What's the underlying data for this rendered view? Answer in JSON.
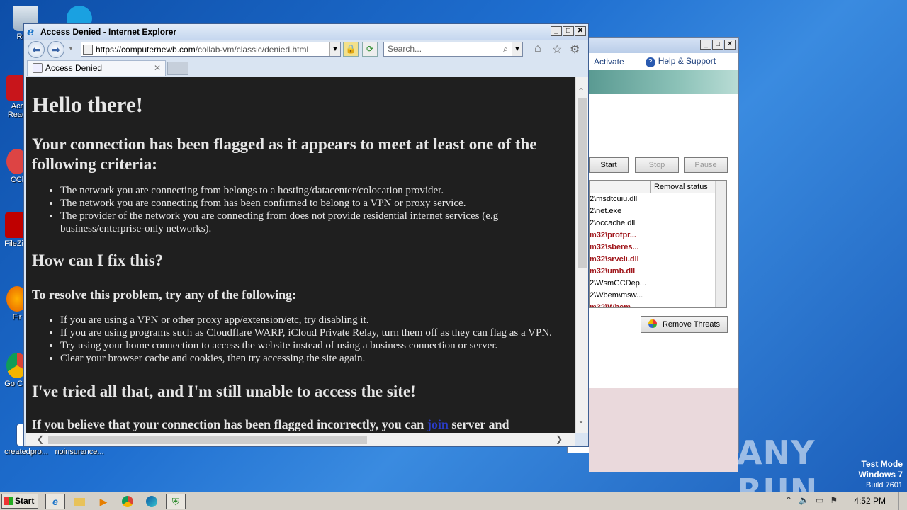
{
  "desktop": {
    "icons": [
      {
        "label": "Recy"
      },
      {
        "label": "Acr Read"
      },
      {
        "label": "CCl"
      },
      {
        "label": "FileZill"
      },
      {
        "label": "Fir"
      },
      {
        "label": "Go Chr"
      },
      {
        "label": "createdpro..."
      },
      {
        "label": "noinsurance..."
      }
    ]
  },
  "bgwindow": {
    "activate": "Activate",
    "help": "Help & Support",
    "start": "Start",
    "stop": "Stop",
    "pause": "Pause",
    "column": "Removal status",
    "rows": [
      {
        "text": "2\\msdtcuiu.dll",
        "red": false
      },
      {
        "text": "2\\net.exe",
        "red": false
      },
      {
        "text": "2\\occache.dll",
        "red": false
      },
      {
        "text": "m32\\profpr...",
        "red": true
      },
      {
        "text": "m32\\sberes...",
        "red": true
      },
      {
        "text": "m32\\srvcli.dll",
        "red": true
      },
      {
        "text": "m32\\umb.dll",
        "red": true
      },
      {
        "text": "2\\WsmGCDep...",
        "red": false
      },
      {
        "text": "2\\Wbem\\msw...",
        "red": false
      },
      {
        "text": "m32\\Wbem...",
        "red": true
      }
    ],
    "remove": "Remove Threats"
  },
  "ie": {
    "title": "Access Denied - Internet Explorer",
    "url_host": "https://computernewb.com",
    "url_path": "/collab-vm/classic/denied.html",
    "search_placeholder": "Search...",
    "tab_label": "Access Denied"
  },
  "page": {
    "h1": "Hello there!",
    "h2_flagged": "Your connection has been flagged as it appears to meet at least one of the following criteria:",
    "criteria": [
      "The network you are connecting from belongs to a hosting/datacenter/colocation provider.",
      "The network you are connecting from has been confirmed to belong to a VPN or proxy service.",
      "The provider of the network you are connecting from does not provide residential internet services (e.g business/enterprise-only networks)."
    ],
    "h2_fix": "How can I fix this?",
    "h3_resolve": "To resolve this problem, try any of the following:",
    "fixes": [
      "If you are using a VPN or other proxy app/extension/etc, try disabling it.",
      "If you are using programs such as Cloudflare WARP, iCloud Private Relay, turn them off as they can flag as a VPN.",
      "Try using your home connection to access the website instead of using a business connection or server.",
      "Clear your browser cache and cookies, then try accessing the site again."
    ],
    "h2_tried": "I've tried all that, and I'm still unable to access the site!",
    "last_pre": "If you believe that your connection has been flagged incorrectly, you can ",
    "last_link": "join",
    "last_post": " server and"
  },
  "taskbar": {
    "start": "Start",
    "clock": "4:52 PM"
  },
  "watermark": {
    "text": "ANY RUN"
  },
  "testmode": {
    "line1": "Test Mode",
    "line2": "Windows 7",
    "line3": "Build 7601"
  }
}
